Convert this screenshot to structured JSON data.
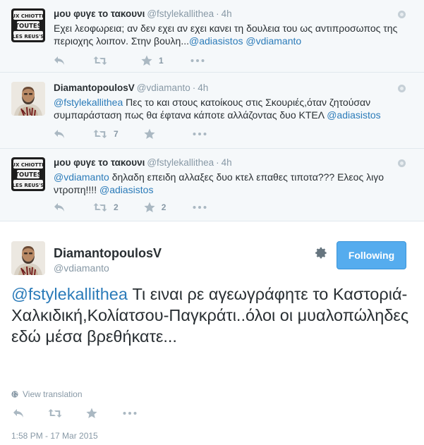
{
  "tweets": [
    {
      "name": "μου φυγε το τακουνι",
      "handle": "@fstylekallithea",
      "separator": "·",
      "time": "4h",
      "text_parts": [
        {
          "t": "Εχει λεοφωρεια; αν δεν εχει αν εχει κανει τη δουλεια του ως αντιπροσωπος της περιοχης λοιπον. Στην βουλη...",
          "link": false
        },
        {
          "t": "@adiasistos",
          "link": true
        },
        {
          "t": " ",
          "link": false
        },
        {
          "t": "@vdiamanto",
          "link": true
        }
      ],
      "retweets": "",
      "favorites": "1",
      "avatar_lines": [
        "AUX CHIOTTES",
        "TOUTES",
        "LES REUS'S"
      ]
    },
    {
      "name": "DiamantopoulosV",
      "handle": "@vdiamanto",
      "separator": "·",
      "time": "4h",
      "text_parts": [
        {
          "t": "@fstylekallithea",
          "link": true
        },
        {
          "t": " Πες το και στους κατοίκους στις Σκουριές,όταν ζητούσαν συμπαράσταση πως θα έφτανα κάποτε αλλάζοντας δυο ΚΤΕΛ ",
          "link": false
        },
        {
          "t": "@adiasistos",
          "link": true
        }
      ],
      "retweets": "7",
      "favorites": ""
    },
    {
      "name": "μου φυγε το τακουνι",
      "handle": "@fstylekallithea",
      "separator": "·",
      "time": "4h",
      "text_parts": [
        {
          "t": "@vdiamanto",
          "link": true
        },
        {
          "t": " δηλαδη επειδη αλλαξες δυο κτελ επαθες τιποτα??? Ελεος λιγο ντροπη!!!!  ",
          "link": false
        },
        {
          "t": "@adiasistos",
          "link": true
        }
      ],
      "retweets": "2",
      "favorites": "2",
      "avatar_lines": [
        "AUX CHIOTTES",
        "TOUTES",
        "LES REUS'S"
      ]
    }
  ],
  "main": {
    "name": "DiamantopoulosV",
    "handle": "@vdiamanto",
    "follow_label": "Following",
    "mention": "@fstylekallithea",
    "text": " Τι ειναι ρε αγεωγράφητε το Καστοριά-Χαλκιδική,Κολίατσου-Παγκράτι..όλοι οι μυαλοπώληδες εδώ μέσα βρεθήκατε...",
    "view_translation": "View translation",
    "timestamp": "1:58 PM - 17 Mar 2015"
  },
  "colors": {
    "link": "#2b7bb9",
    "follow_button": "#55acee",
    "muted": "#8899a6",
    "thread_bg": "#f5f8fa"
  },
  "icons": [
    "reply-icon",
    "retweet-icon",
    "favorite-icon",
    "more-icon",
    "gear-icon",
    "globe-icon",
    "tweet-options-icon"
  ]
}
